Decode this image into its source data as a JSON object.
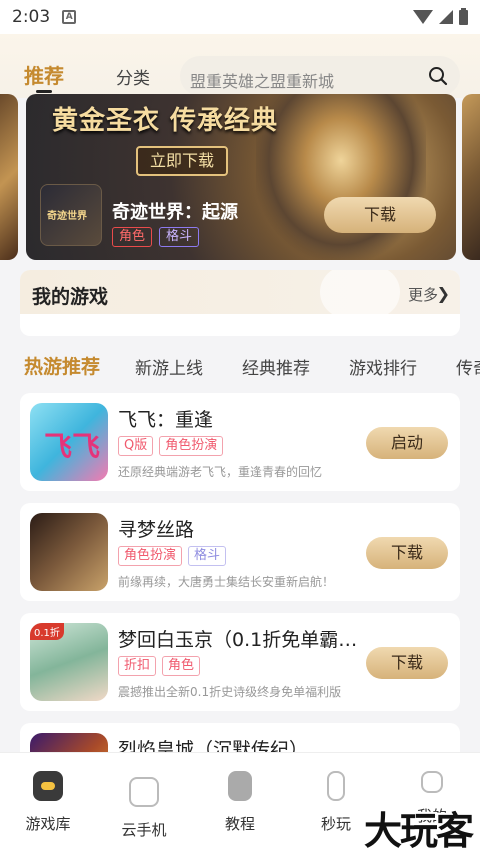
{
  "status_bar": {
    "time": "2:03",
    "notif_icon": "A"
  },
  "top_tabs": {
    "recommend": "推荐",
    "category": "分类"
  },
  "search": {
    "placeholder": "盟重英雄之盟重新城"
  },
  "banner": {
    "headline": "黄金圣衣 传承经典",
    "mini_button": "立即下载",
    "icon_text": "奇迹世界",
    "game_name": "奇迹世界：起源",
    "tags": [
      "角色",
      "格斗"
    ],
    "download": "下载"
  },
  "my_games": {
    "title": "我的游戏",
    "more": "更多"
  },
  "category_tabs": [
    "热游推荐",
    "新游上线",
    "经典推荐",
    "游戏排行",
    "传奇"
  ],
  "games": [
    {
      "name": "飞飞：重逢",
      "tags": [
        "Q版",
        "角色扮演"
      ],
      "desc": "还原经典端游老飞飞，重逢青春的回忆",
      "button": "启动",
      "icon_text": "飞飞"
    },
    {
      "name": "寻梦丝路",
      "tags": [
        "角色扮演",
        "格斗"
      ],
      "desc": "前缘再续，大唐勇士集结长安重新启航！",
      "button": "下载"
    },
    {
      "name": "梦回白玉京（0.1折免单霸…",
      "tags": [
        "折扣",
        "角色"
      ],
      "desc": "震撼推出全新0.1折史诗级终身免单福利版",
      "button": "下载",
      "badge": "0.1折"
    },
    {
      "name": "烈焰皇城（沉默传纪）"
    }
  ],
  "bottom_nav": [
    "游戏库",
    "云手机",
    "教程",
    "秒玩",
    "我的"
  ],
  "watermark": "大玩客",
  "colors": {
    "accent": "#c58a2f",
    "button_gold": "#d6b27a",
    "tag_pink": "#f05a6e",
    "tag_blue": "#8f8de0"
  }
}
